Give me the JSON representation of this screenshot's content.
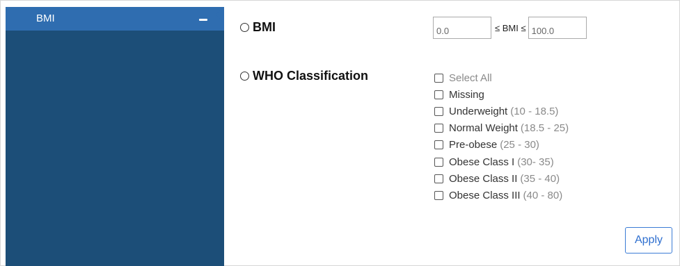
{
  "sidebar": {
    "title": "BMI",
    "collapse_icon": "minus-icon"
  },
  "options": {
    "bmi": {
      "label": "BMI",
      "selected": false
    },
    "who": {
      "label": "WHO Classification",
      "selected": false
    }
  },
  "bmi_range": {
    "min_value": "0.0",
    "label": "≤ BMI ≤",
    "max_value": "100.0"
  },
  "who_items": [
    {
      "label": "Select All",
      "range": "",
      "checked": false
    },
    {
      "label": "Missing",
      "range": "",
      "checked": false
    },
    {
      "label": "Underweight",
      "range": "(10 - 18.5)",
      "checked": false
    },
    {
      "label": "Normal Weight",
      "range": "(18.5 - 25)",
      "checked": false
    },
    {
      "label": "Pre-obese",
      "range": "(25 - 30)",
      "checked": false
    },
    {
      "label": "Obese Class I",
      "range": "(30- 35)",
      "checked": false
    },
    {
      "label": "Obese Class II",
      "range": "(35 - 40)",
      "checked": false
    },
    {
      "label": "Obese Class III",
      "range": "(40 - 80)",
      "checked": false
    }
  ],
  "apply_label": "Apply",
  "colors": {
    "sidebar_bg": "#1c4e78",
    "sidebar_header": "#2f6db0",
    "accent": "#2e6fcf"
  }
}
